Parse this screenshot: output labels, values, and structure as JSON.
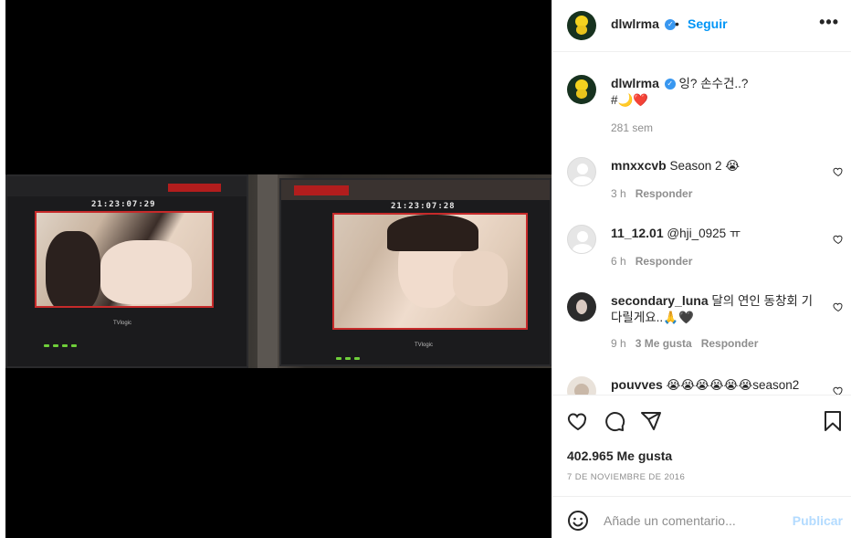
{
  "post": {
    "username": "dlwlrma",
    "follow_label": "Seguir",
    "separator": "•",
    "more_label": "•••",
    "caption_text": "잉? 손수건..?",
    "caption_line2": "#🌙❤️",
    "caption_age": "281 sem",
    "likes": "402.965 Me gusta",
    "date": "7 DE NOVIEMBRE DE 2016",
    "add_comment_placeholder": "Añade un comentario...",
    "publish_label": "Publicar"
  },
  "photo": {
    "timecode_left": "21:23:07:29",
    "timecode_right": "21:23:07:28",
    "brand_left": "TVlogic",
    "brand_right": "TVlogic"
  },
  "comments": [
    {
      "user": "mnxxcvb",
      "text": "Season 2 😭",
      "time": "3 h",
      "likes": "",
      "reply": "Responder"
    },
    {
      "user": "11_12.01",
      "text": "@hji_0925 ㅠ",
      "time": "6 h",
      "likes": "",
      "reply": "Responder"
    },
    {
      "user": "secondary_luna",
      "text": "달의 연인 동창회 기다릴게요..🙏🖤",
      "time": "9 h",
      "likes": "3 Me gusta",
      "reply": "Responder"
    },
    {
      "user": "pouvves",
      "text": "😭😭😭😭😭😭season2",
      "time": "",
      "likes": "",
      "reply": ""
    }
  ],
  "icons": {
    "like": "heart-icon",
    "comment": "comment-icon",
    "share": "share-icon",
    "save": "bookmark-icon",
    "emoji": "emoji-icon",
    "verified": "verified-badge-icon",
    "comment_like": "small-heart-icon"
  },
  "colors": {
    "accent": "#0095f6",
    "verified": "#3897f0",
    "publish_disabled": "#b3dbff",
    "muted": "#8e8e8e"
  }
}
